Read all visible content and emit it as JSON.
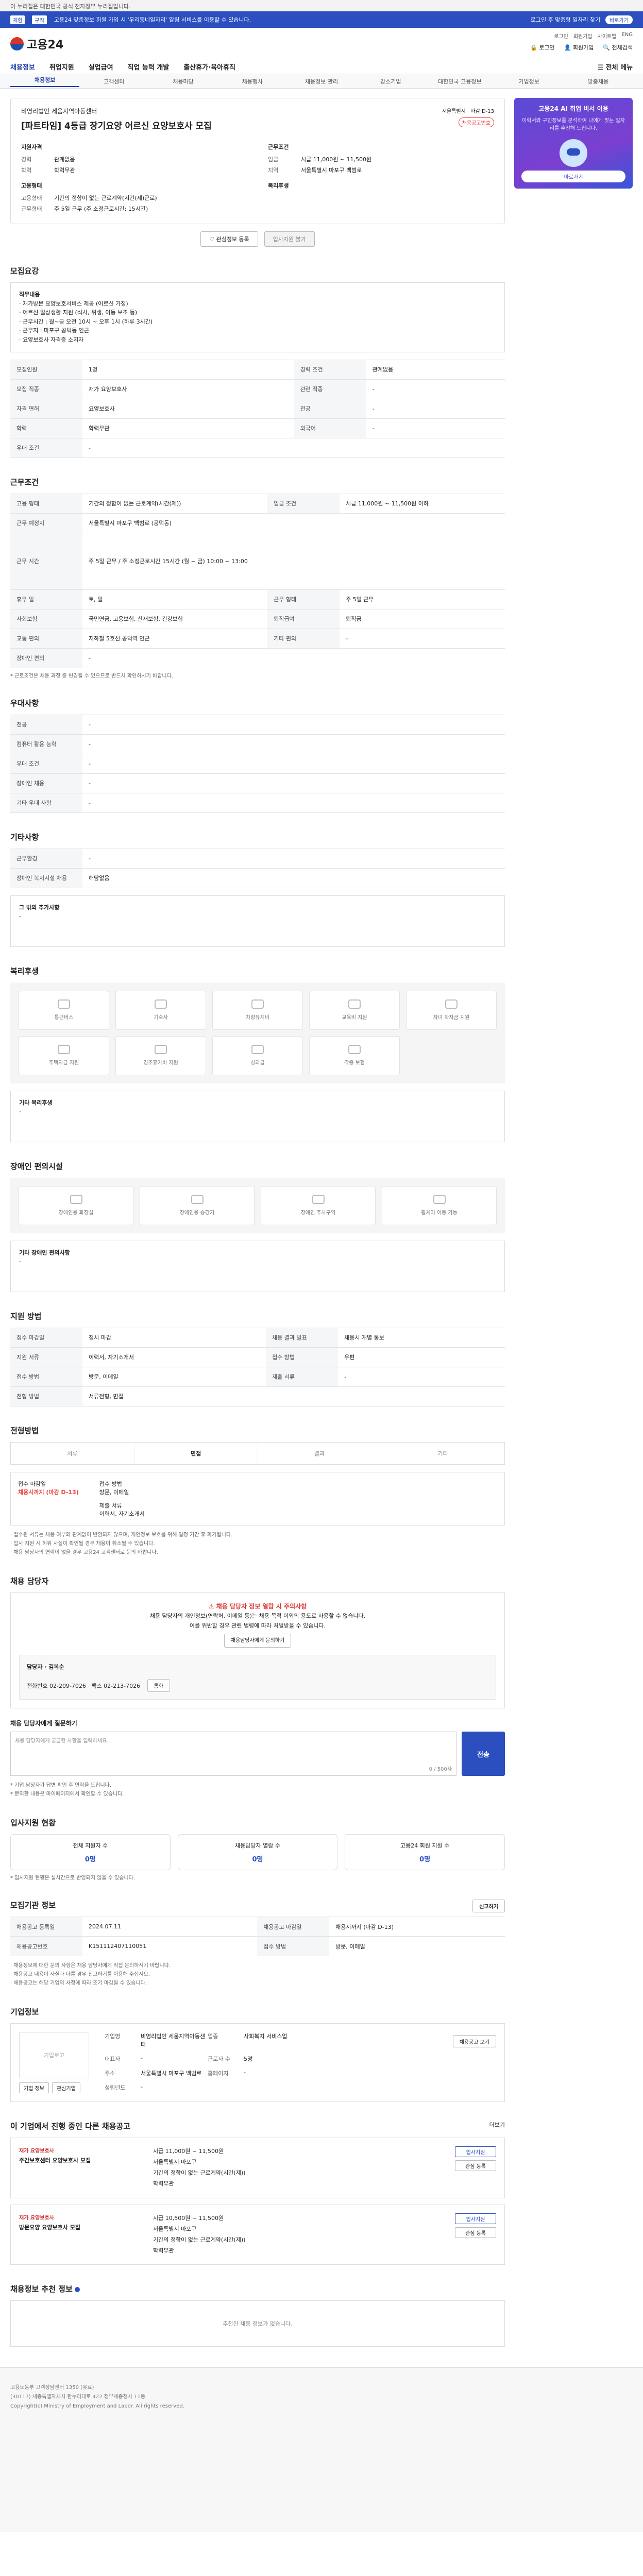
{
  "top": {
    "notice": "이 누리집은 대한민국 공식 전자정부 누리집입니다."
  },
  "banner": {
    "tag1": "체험",
    "tag2": "구직",
    "text": "고용24 맞춤정보 회원 가입 시 '우리동네일자리' 알림 서비스를 이용할 수 있습니다.",
    "right1": "로그인 후 맞춤형 일자리 찾기",
    "right2": "바로가기"
  },
  "header": {
    "logo": "고용24",
    "links": [
      "로그인",
      "회원가입",
      "사이트맵",
      "ENG"
    ],
    "icons": [
      "로그인",
      "회원가입",
      "전체검색"
    ]
  },
  "gnb": {
    "items": [
      "채용정보",
      "취업지원",
      "실업급여",
      "직업 능력 개발",
      "출산휴가·육아휴직"
    ],
    "all": "전체 메뉴"
  },
  "subgnb": {
    "items": [
      "채용정보",
      "고객센터",
      "채용마당",
      "채용행사",
      "채용정보 관리",
      "강소기업",
      "대한민국 고용정보",
      "기업정보",
      "맞춤채용"
    ]
  },
  "ad": {
    "t1": "고용24 AI 취업 비서 이용",
    "t2": "이력서와 구인정보를 분석하여 나에게 맞는 일자리를 추천해 드립니다.",
    "cta": "바로가기"
  },
  "card": {
    "company": "비영리법인 세움지역아동센터",
    "title": "[파트타임] 4등급 장기요양 어르신 요양보호사 모집",
    "stamp1": "서울특별시",
    "stamp2": "마감 D-13",
    "badge": "채용공고번호",
    "left_h": "지원자격",
    "right_h": "근무조건",
    "left": [
      {
        "k": "경력",
        "v": "관계없음"
      },
      {
        "k": "학력",
        "v": "학력무관"
      }
    ],
    "right": [
      {
        "k": "임금",
        "v": "시급 11,000원 ~ 11,500원"
      },
      {
        "k": "지역",
        "v": "서울특별시 마포구 백범로"
      }
    ],
    "left2_h": "고용형태",
    "right2_h": "복리후생",
    "left2": [
      {
        "k": "고용형태",
        "v": "기간의 정함이 없는 근로계약(시간(제)근로)"
      },
      {
        "k": "근무형태",
        "v": "주 5일 근무 (주 소정근로시간: 15시간)"
      }
    ],
    "btn1": "관심정보 등록",
    "btn2": "입사지원 불가"
  },
  "recruit": {
    "h": "모집요강",
    "jobdesc_h": "직무내용",
    "jobdesc": [
      "· 재가방문 요양보호서비스 제공 (어르신 가정)",
      "· 어르신 일상생활 지원 (식사, 위생, 이동 보조 등)",
      "· 근무시간 : 월~금 오전 10시 ~ 오후 1시 (하루 3시간)",
      "· 근무지 : 마포구 공덕동 인근",
      "· 요양보호사 자격증 소지자"
    ],
    "rows": [
      [
        "모집인원",
        "1명",
        "경력 조건",
        "관계없음"
      ],
      [
        "모집 직종",
        "재가 요양보호사",
        "관련 직종",
        "-"
      ],
      [
        "자격 면허",
        "요양보호사",
        "전공",
        "-"
      ],
      [
        "학력",
        "학력무관",
        "외국어",
        "-"
      ],
      [
        "우대 조건",
        "-",
        "",
        ""
      ]
    ]
  },
  "cond": {
    "h": "근무조건",
    "rows": [
      [
        "고용 형태",
        "기간의 정함이 없는 근로계약(시간(제))",
        "임금 조건",
        "시급 11,000원 ~ 11,500원 이하"
      ],
      [
        "근무 예정지",
        "서울특별시 마포구 백범로 (공덕동)",
        "",
        ""
      ],
      [
        "근무 시간",
        "주 5일 근무 / 주 소정근로시간 15시간 (월 ~ 금) 10:00 ~ 13:00",
        "",
        ""
      ],
      [
        "휴무 일",
        "토, 일",
        "근무 형태",
        "주 5일 근무"
      ],
      [
        "사회보험",
        "국민연금, 고용보험, 산재보험, 건강보험",
        "퇴직급여",
        "퇴직금"
      ],
      [
        "교통 편의",
        "지하철 5호선 공덕역 인근",
        "기타 편의",
        "-"
      ],
      [
        "장애인 편의",
        "-",
        "",
        ""
      ]
    ],
    "note": "* 근로조건은 채용 과정 중 변경될 수 있으므로 반드시 확인하시기 바랍니다."
  },
  "pref": {
    "h": "우대사항",
    "rows": [
      [
        "전공",
        "-"
      ],
      [
        "컴퓨터 활용 능력",
        "-"
      ],
      [
        "우대 조건",
        "-"
      ],
      [
        "장애인 채용",
        "-"
      ],
      [
        "기타 우대 사항",
        "-"
      ]
    ]
  },
  "other": {
    "h": "기타사항",
    "rows": [
      [
        "근무환경",
        "-"
      ],
      [
        "장애인 복지시설 채용",
        "해당없음"
      ]
    ],
    "note_h": "그 밖의 추가사항",
    "note": "-"
  },
  "welfare": {
    "h": "복리후생",
    "tiles": [
      "통근버스",
      "기숙사",
      "차량유지비",
      "교육비 지원",
      "자녀 학자금 지원",
      "주택자금 지원",
      "경조휴가비 지원",
      "성과급",
      "각종 보험"
    ],
    "etc_h": "기타 복리후생",
    "etc": "-"
  },
  "disabled": {
    "h": "장애인 편의시설",
    "tiles": [
      "장애인용 화장실",
      "장애인용 승강기",
      "장애인 주차구역",
      "휠체어 이동 가능"
    ],
    "etc_h": "기타 장애인 편의사항",
    "etc": "-"
  },
  "apply": {
    "h": "지원 방법",
    "rows": [
      [
        "접수 마감일",
        "정시 마감",
        "채용 결과 발표",
        "채용시 개별 통보"
      ],
      [
        "접수 방법",
        "방문, 이메일",
        "",
        "제출 서류"
      ],
      [
        "전형 방법",
        "서류전형, 면접",
        "",
        ""
      ]
    ],
    "mid_rows": [
      [
        "지원 서류",
        "이력서, 자기소개서"
      ],
      [
        "접수 방법",
        "우편"
      ],
      [
        "제출 서류",
        "-"
      ]
    ]
  },
  "process": {
    "h": "전형방법",
    "steps": [
      "서류",
      "면접",
      "결과",
      "기타"
    ],
    "info_h": "접수 마감일",
    "deadline": "채용시까지 (마감 D-13)",
    "ptype_h": "접수 방법",
    "ptype": "방문, 이메일",
    "doc_h": "제출 서류",
    "doc": "이력서, 자기소개서",
    "notes": [
      "· 접수된 서류는 채용 여부와 관계없이 반환되지 않으며, 개인정보 보호를 위해 일정 기간 후 파기됩니다.",
      "· 입사 지원 시 허위 사실이 확인될 경우 채용이 취소될 수 있습니다.",
      "· 채용 담당자의 연락이 없을 경우 고용24 고객센터로 문의 바랍니다."
    ]
  },
  "contact": {
    "h": "채용 담당자",
    "alert_ttl": "채용 담당자 정보 열람 시 주의사항",
    "alert": [
      "채용 담당자의 개인정보(연락처, 이메일 등)는 채용 목적 이외의 용도로 사용할 수 없습니다.",
      "이를 위반할 경우 관련 법령에 따라 처벌받을 수 있습니다."
    ],
    "btn": "채용담당자에게 문의하기",
    "name_h": "담당자",
    "name": "김복순",
    "tel_h": "전화번호",
    "tel": "02-209-7026",
    "fax_h": "팩스",
    "fax": "02-213-7026",
    "call": "통화",
    "msg_h": "채용 담당자에게 질문하기",
    "placeholder": "채용 담당자에게 궁금한 사항을 입력하세요.",
    "count": "0 / 500자",
    "send": "전송",
    "notes": [
      "* 기업 담당자가 답변 확인 후 연락을 드립니다.",
      "* 문의한 내용은 마이페이지에서 확인할 수 있습니다."
    ]
  },
  "stats": {
    "h": "입사지원 현황",
    "items": [
      {
        "k": "전체 지원자 수",
        "v": "0명"
      },
      {
        "k": "채용담당자 열람 수",
        "v": "0명"
      },
      {
        "k": "고용24 회원 지원 수",
        "v": "0명"
      }
    ],
    "note": "* 입사지원 현황은 실시간으로 반영되지 않을 수 있습니다."
  },
  "meta": {
    "h": "모집기관 정보",
    "btn": "신고하기",
    "rows": [
      [
        "채용공고 등록일",
        "2024.07.11",
        "채용공고 마감일",
        "채용시까지 (마감 D-13)"
      ],
      [
        "채용공고번호",
        "K151112407110051",
        "접수 방법",
        "방문, 이메일"
      ]
    ],
    "notes": [
      "· 채용정보에 대한 문의 사항은 채용 담당자에게 직접 문의하시기 바랍니다.",
      "· 채용공고 내용이 사실과 다를 경우 신고하기를 이용해 주십시오.",
      "· 채용공고는 해당 기업의 사정에 따라 조기 마감될 수 있습니다."
    ]
  },
  "org": {
    "h": "기업정보",
    "logo": "기업로고",
    "btn1": "기업 정보",
    "btn2": "관심기업",
    "rows": [
      [
        "기업명",
        "비영리법인 세움지역아동센터",
        "업종",
        "사회복지 서비스업"
      ],
      [
        "대표자",
        "-",
        "근로자 수",
        "5명"
      ],
      [
        "주소",
        "서울특별시 마포구 백범로",
        "홈페이지",
        "-"
      ],
      [
        "설립년도",
        "-",
        "",
        ""
      ]
    ],
    "more": "채용공고 보기"
  },
  "related": {
    "h": "이 기업에서 진행 중인 다른 채용공고",
    "more": "더보기",
    "jobs": [
      {
        "cat": "재가 요양보호사",
        "title": "주간보호센터 요양보호사 모집",
        "pay": "시급 11,000원 ~ 11,500원",
        "place": "서울특별시 마포구",
        "type": "기간의 정함이 없는 근로계약(시간(제))",
        "edu": "학력무관",
        "btn1": "입사지원",
        "btn2": "관심 등록"
      },
      {
        "cat": "재가 요양보호사",
        "title": "방문요양 요양보호사 모집",
        "pay": "시급 10,500원 ~ 11,500원",
        "place": "서울특별시 마포구",
        "type": "기간의 정함이 없는 근로계약(시간(제))",
        "edu": "학력무관",
        "btn1": "입사지원",
        "btn2": "관심 등록"
      }
    ]
  },
  "recommend": {
    "h": "채용정보 추천 정보",
    "empty": "추천된 채용 정보가 없습니다."
  },
  "footer": {
    "lines": [
      "고용노동부 고객상담센터 1350 (유료)",
      "(30117) 세종특별자치시 한누리대로 422 정부세종청사 11동",
      "Copyright(c) Ministry of Employment and Labor. All rights reserved."
    ]
  }
}
